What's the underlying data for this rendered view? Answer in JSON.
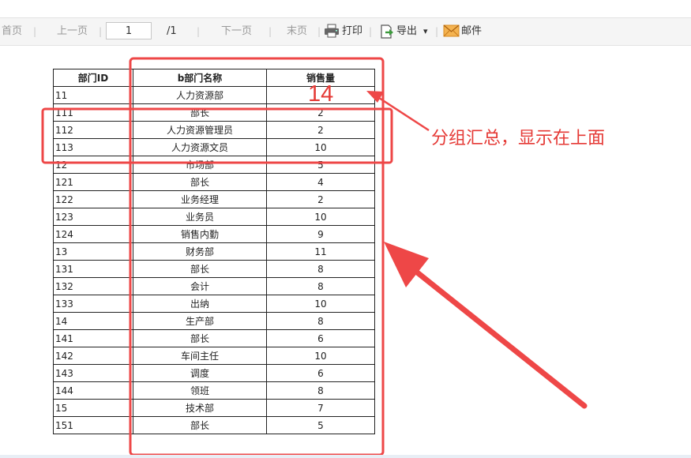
{
  "toolbar": {
    "first": "首页",
    "prev": "上一页",
    "page_value": "1",
    "page_total": "/1",
    "next": "下一页",
    "last": "末页",
    "print": "打印",
    "export": "导出",
    "export_caret": "▾",
    "mail": "邮件"
  },
  "report": {
    "headers": [
      "部门ID",
      "b部门名称",
      "销售量"
    ],
    "rows": [
      {
        "id": "11",
        "name": "人力资源部",
        "qty": ""
      },
      {
        "id": "111",
        "name": "部长",
        "qty": "2"
      },
      {
        "id": "112",
        "name": "人力资源管理员",
        "qty": "2"
      },
      {
        "id": "113",
        "name": "人力资源文员",
        "qty": "10"
      },
      {
        "id": "12",
        "name": "市场部",
        "qty": "5"
      },
      {
        "id": "121",
        "name": "部长",
        "qty": "4"
      },
      {
        "id": "122",
        "name": "业务经理",
        "qty": "2"
      },
      {
        "id": "123",
        "name": "业务员",
        "qty": "10"
      },
      {
        "id": "124",
        "name": "销售内勤",
        "qty": "9"
      },
      {
        "id": "13",
        "name": "财务部",
        "qty": "11"
      },
      {
        "id": "131",
        "name": "部长",
        "qty": "8"
      },
      {
        "id": "132",
        "name": "会计",
        "qty": "8"
      },
      {
        "id": "133",
        "name": "出纳",
        "qty": "10"
      },
      {
        "id": "14",
        "name": "生产部",
        "qty": "8"
      },
      {
        "id": "141",
        "name": "部长",
        "qty": "6"
      },
      {
        "id": "142",
        "name": "车间主任",
        "qty": "10"
      },
      {
        "id": "143",
        "name": "调度",
        "qty": "6"
      },
      {
        "id": "144",
        "name": "领班",
        "qty": "8"
      },
      {
        "id": "15",
        "name": "技术部",
        "qty": "7"
      },
      {
        "id": "151",
        "name": "部长",
        "qty": "5"
      }
    ]
  },
  "annotations": {
    "group_total": "14",
    "note": "分组汇总，显示在上面",
    "color": "#e53935"
  },
  "colors": {
    "toolbar_bg": "#f5f5f5",
    "disabled_text": "#999999",
    "annotation_red": "#e53935",
    "export_green": "#3c9a3c",
    "mail_orange": "#f0a030"
  }
}
